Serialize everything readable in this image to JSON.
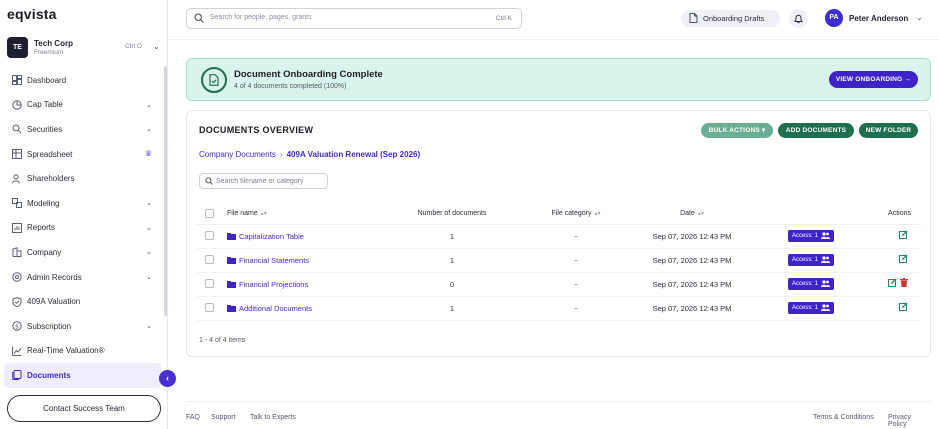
{
  "app": {
    "logo": "eqvista"
  },
  "company": {
    "initials": "TE",
    "name": "Tech Corp",
    "plan": "Freemium",
    "shortcut": "Ctrl O"
  },
  "sidebar": {
    "items": [
      {
        "label": "Dashboard",
        "icon": "dashboard-icon",
        "expandable": false
      },
      {
        "label": "Cap Table",
        "icon": "pie-chart-icon",
        "expandable": true
      },
      {
        "label": "Securities",
        "icon": "securities-icon",
        "expandable": true
      },
      {
        "label": "Spreadsheet",
        "icon": "spreadsheet-icon",
        "expandable": false,
        "badge": "crown-icon"
      },
      {
        "label": "Shareholders",
        "icon": "users-icon",
        "expandable": false
      },
      {
        "label": "Modeling",
        "icon": "modeling-icon",
        "expandable": true
      },
      {
        "label": "Reports",
        "icon": "reports-icon",
        "expandable": true
      },
      {
        "label": "Company",
        "icon": "company-icon",
        "expandable": true
      },
      {
        "label": "Admin Records",
        "icon": "admin-icon",
        "expandable": true
      },
      {
        "label": "409A Valuation",
        "icon": "shield-icon",
        "expandable": false
      },
      {
        "label": "Subscription",
        "icon": "subscription-icon",
        "expandable": true
      },
      {
        "label": "Real-Time Valuation®",
        "icon": "trend-icon",
        "expandable": false
      },
      {
        "label": "Documents",
        "icon": "documents-icon",
        "expandable": false,
        "active": true
      }
    ],
    "contact_label": "Contact Success Team"
  },
  "topbar": {
    "search_placeholder": "Search for people, pages, grants",
    "search_shortcut": "Ctrl K",
    "drafts_label": "Onboarding Drafts",
    "user_initials": "PA",
    "user_name": "Peter Anderson"
  },
  "banner": {
    "title": "Document Onboarding Complete",
    "subtitle": "4 of 4 documents completed (100%)",
    "button_label": "VIEW ONBOARDING →"
  },
  "documents": {
    "title": "DOCUMENTS OVERVIEW",
    "bulk_label": "BULK ACTIONS",
    "add_label": "ADD DOCUMENTS",
    "folder_label": "NEW FOLDER",
    "breadcrumb_root": "Company Documents",
    "breadcrumb_current": "409A Valuation Renewal (Sep 2026)",
    "filter_placeholder": "Search filename or category",
    "columns": {
      "name": "File name",
      "num": "Number of documents",
      "cat": "File category",
      "date": "Date",
      "actions": "Actions"
    },
    "rows": [
      {
        "name": "Capitalization Table",
        "num": "1",
        "cat": "-",
        "date": "Sep 07, 2026 12:43 PM",
        "access": "Access: 1",
        "deletable": false
      },
      {
        "name": "Financial Statements",
        "num": "1",
        "cat": "-",
        "date": "Sep 07, 2026 12:43 PM",
        "access": "Access: 1",
        "deletable": false
      },
      {
        "name": "Financial Projections",
        "num": "0",
        "cat": "-",
        "date": "Sep 07, 2026 12:43 PM",
        "access": "Access: 1",
        "deletable": true
      },
      {
        "name": "Additional Documents",
        "num": "1",
        "cat": "-",
        "date": "Sep 07, 2026 12:43 PM",
        "access": "Access: 1",
        "deletable": false
      }
    ],
    "count_label": "1 - 4 of 4 items"
  },
  "footer": {
    "faq": "FAQ",
    "support": "Support",
    "experts": "Talk to Experts",
    "terms": "Terms & Conditions",
    "privacy": "Privacy Policy"
  },
  "colors": {
    "brand": "#3f23c9",
    "success": "#1d6f4f",
    "banner_bg": "#d9f4ec",
    "danger": "#d63030"
  }
}
